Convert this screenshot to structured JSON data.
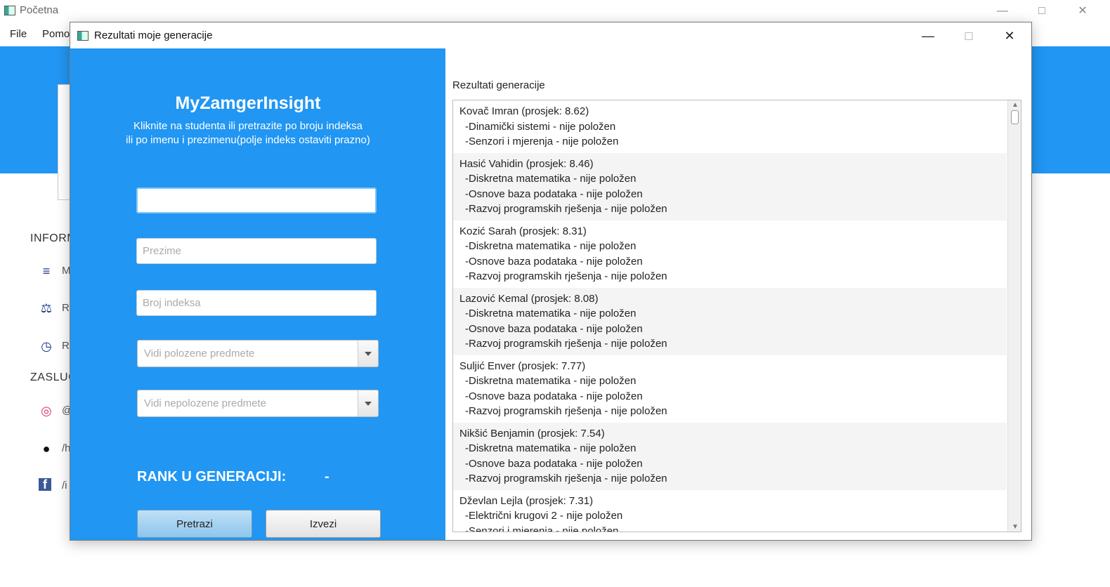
{
  "main_window": {
    "title": "Početna",
    "menu": [
      "File",
      "Pomo"
    ],
    "sidebar_sections": [
      "INFORM",
      "ZASLUG"
    ],
    "sidebar_items": [
      {
        "icon": "list-icon",
        "glyph": "≡",
        "label": "M"
      },
      {
        "icon": "scale-icon",
        "glyph": "⚖",
        "label": "Re"
      },
      {
        "icon": "clock-icon",
        "glyph": "◷",
        "label": "Re"
      },
      {
        "icon": "instagram-icon",
        "glyph": "◎",
        "label": "@"
      },
      {
        "icon": "github-icon",
        "glyph": "●",
        "label": "/h"
      },
      {
        "icon": "facebook-icon",
        "glyph": "f",
        "label": "/i"
      }
    ]
  },
  "dialog": {
    "title": "Rezultati moje generacije",
    "app_name": "MyZamgerInsight",
    "subtitle_line1": "Kliknite na studenta ili pretrazite po broju indeksa",
    "subtitle_line2": "ili po imenu i prezimenu(polje indeks ostaviti prazno)",
    "name_field": {
      "value": "",
      "placeholder": ""
    },
    "surname_field": {
      "placeholder": "Prezime"
    },
    "index_field": {
      "placeholder": "Broj indeksa"
    },
    "passed_combo": {
      "placeholder": "Vidi polozene predmete"
    },
    "failed_combo": {
      "placeholder": "Vidi nepolozene predmete"
    },
    "rank_label": "RANK U GENERACIJI:",
    "rank_value": "-",
    "search_button": "Pretrazi",
    "export_button": "Izvezi",
    "results_title": "Rezultati generacije",
    "results": [
      {
        "header": "Kovač Imran (prosjek: 8.62)",
        "subjects": [
          "-Dinamički sistemi - nije položen",
          "-Senzori i mjerenja - nije položen"
        ]
      },
      {
        "header": "Hasić Vahidin (prosjek: 8.46)",
        "subjects": [
          "-Diskretna matematika - nije položen",
          "-Osnove baza podataka - nije položen",
          "-Razvoj programskih rješenja - nije položen"
        ]
      },
      {
        "header": "Kozić Sarah (prosjek: 8.31)",
        "subjects": [
          "-Diskretna matematika - nije položen",
          "-Osnove baza podataka - nije položen",
          "-Razvoj programskih rješenja - nije položen"
        ]
      },
      {
        "header": "Lazović Kemal (prosjek: 8.08)",
        "subjects": [
          "-Diskretna matematika - nije položen",
          "-Osnove baza podataka - nije položen",
          "-Razvoj programskih rješenja - nije položen"
        ]
      },
      {
        "header": "Suljić Enver (prosjek: 7.77)",
        "subjects": [
          "-Diskretna matematika - nije položen",
          "-Osnove baza podataka - nije položen",
          "-Razvoj programskih rješenja - nije položen"
        ]
      },
      {
        "header": "Nikšić Benjamin (prosjek: 7.54)",
        "subjects": [
          "-Diskretna matematika - nije položen",
          "-Osnove baza podataka - nije položen",
          "-Razvoj programskih rješenja - nije položen"
        ]
      },
      {
        "header": "Dževlan Lejla (prosjek: 7.31)",
        "subjects": [
          "-Električni krugovi 2 - nije položen",
          "-Senzori i mjerenja - nije položen"
        ]
      }
    ]
  },
  "colors": {
    "accent_blue": "#2196f3"
  }
}
